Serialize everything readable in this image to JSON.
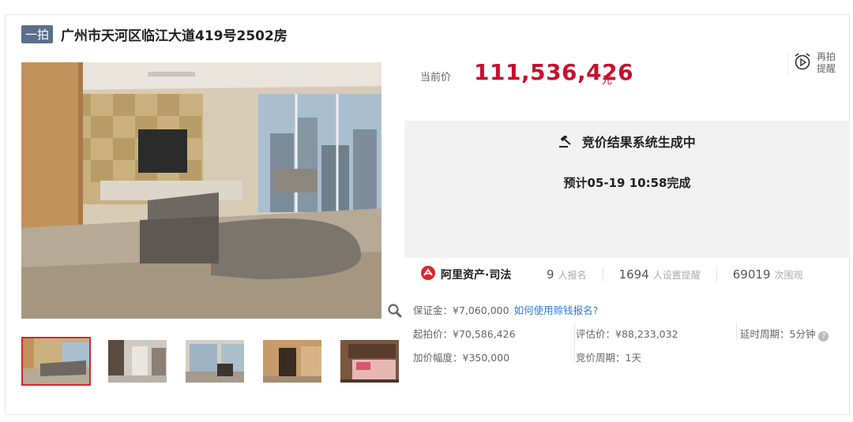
{
  "listing": {
    "badge": "一拍",
    "title": "广州市天河区临江大道419号2502房"
  },
  "price": {
    "label": "当前价",
    "value": "111,536,426",
    "unit": "元"
  },
  "remind": {
    "label_line1": "再拍",
    "label_line2": "提醒"
  },
  "result": {
    "title": "竞价结果系统生成中",
    "subtitle": "预计05-19 10:58完成"
  },
  "platform": {
    "name": "阿里资产·司法"
  },
  "stats": [
    {
      "num": "9",
      "unit": "人报名"
    },
    {
      "num": "1694",
      "unit": "人设置提醒"
    },
    {
      "num": "69019",
      "unit": "次围观"
    }
  ],
  "deposit": {
    "text": "保证金：¥7,060,000",
    "link": "如何使用赊钱报名?"
  },
  "details": {
    "start_price": "起拍价：¥70,586,426",
    "appraisal": "评估价：¥88,233,032",
    "delay": "延时周期：5分钟",
    "increment": "加价幅度：¥350,000",
    "cycle": "竞价周期：1天"
  },
  "colors": {
    "accent_red": "#c8102e",
    "link_blue": "#2a7ae2",
    "badge_bg": "#5b6f8c"
  }
}
